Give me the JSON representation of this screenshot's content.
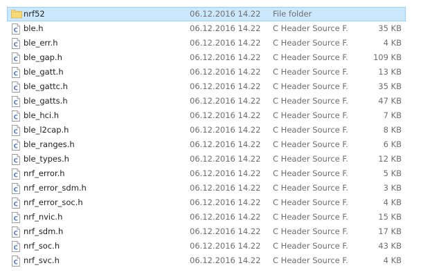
{
  "files": [
    {
      "name": "nrf52",
      "date": "06.12.2016 14.22",
      "type": "File folder",
      "size": "",
      "icon": "folder-icon",
      "selected": true
    },
    {
      "name": "ble.h",
      "date": "06.12.2016 14.22",
      "type": "C Header Source F...",
      "size": "35 KB",
      "icon": "c-header-file-icon"
    },
    {
      "name": "ble_err.h",
      "date": "06.12.2016 14.22",
      "type": "C Header Source F...",
      "size": "4 KB",
      "icon": "c-header-file-icon"
    },
    {
      "name": "ble_gap.h",
      "date": "06.12.2016 14.22",
      "type": "C Header Source F...",
      "size": "109 KB",
      "icon": "c-header-file-icon"
    },
    {
      "name": "ble_gatt.h",
      "date": "06.12.2016 14.22",
      "type": "C Header Source F...",
      "size": "13 KB",
      "icon": "c-header-file-icon"
    },
    {
      "name": "ble_gattc.h",
      "date": "06.12.2016 14.22",
      "type": "C Header Source F...",
      "size": "35 KB",
      "icon": "c-header-file-icon"
    },
    {
      "name": "ble_gatts.h",
      "date": "06.12.2016 14.22",
      "type": "C Header Source F...",
      "size": "47 KB",
      "icon": "c-header-file-icon"
    },
    {
      "name": "ble_hci.h",
      "date": "06.12.2016 14.22",
      "type": "C Header Source F...",
      "size": "7 KB",
      "icon": "c-header-file-icon"
    },
    {
      "name": "ble_l2cap.h",
      "date": "06.12.2016 14.22",
      "type": "C Header Source F...",
      "size": "8 KB",
      "icon": "c-header-file-icon"
    },
    {
      "name": "ble_ranges.h",
      "date": "06.12.2016 14.22",
      "type": "C Header Source F...",
      "size": "6 KB",
      "icon": "c-header-file-icon"
    },
    {
      "name": "ble_types.h",
      "date": "06.12.2016 14.22",
      "type": "C Header Source F...",
      "size": "12 KB",
      "icon": "c-header-file-icon"
    },
    {
      "name": "nrf_error.h",
      "date": "06.12.2016 14.22",
      "type": "C Header Source F...",
      "size": "5 KB",
      "icon": "c-header-file-icon"
    },
    {
      "name": "nrf_error_sdm.h",
      "date": "06.12.2016 14.22",
      "type": "C Header Source F...",
      "size": "3 KB",
      "icon": "c-header-file-icon"
    },
    {
      "name": "nrf_error_soc.h",
      "date": "06.12.2016 14.22",
      "type": "C Header Source F...",
      "size": "4 KB",
      "icon": "c-header-file-icon"
    },
    {
      "name": "nrf_nvic.h",
      "date": "06.12.2016 14.22",
      "type": "C Header Source F...",
      "size": "15 KB",
      "icon": "c-header-file-icon"
    },
    {
      "name": "nrf_sdm.h",
      "date": "06.12.2016 14.22",
      "type": "C Header Source F...",
      "size": "17 KB",
      "icon": "c-header-file-icon"
    },
    {
      "name": "nrf_soc.h",
      "date": "06.12.2016 14.22",
      "type": "C Header Source F...",
      "size": "43 KB",
      "icon": "c-header-file-icon"
    },
    {
      "name": "nrf_svc.h",
      "date": "06.12.2016 14.22",
      "type": "C Header Source F...",
      "size": "4 KB",
      "icon": "c-header-file-icon"
    }
  ],
  "colors": {
    "selection_fill": "#cce8ff",
    "selection_border": "#99d1ff",
    "folder": "#f8d775",
    "c_badge": "#4a78c2"
  }
}
